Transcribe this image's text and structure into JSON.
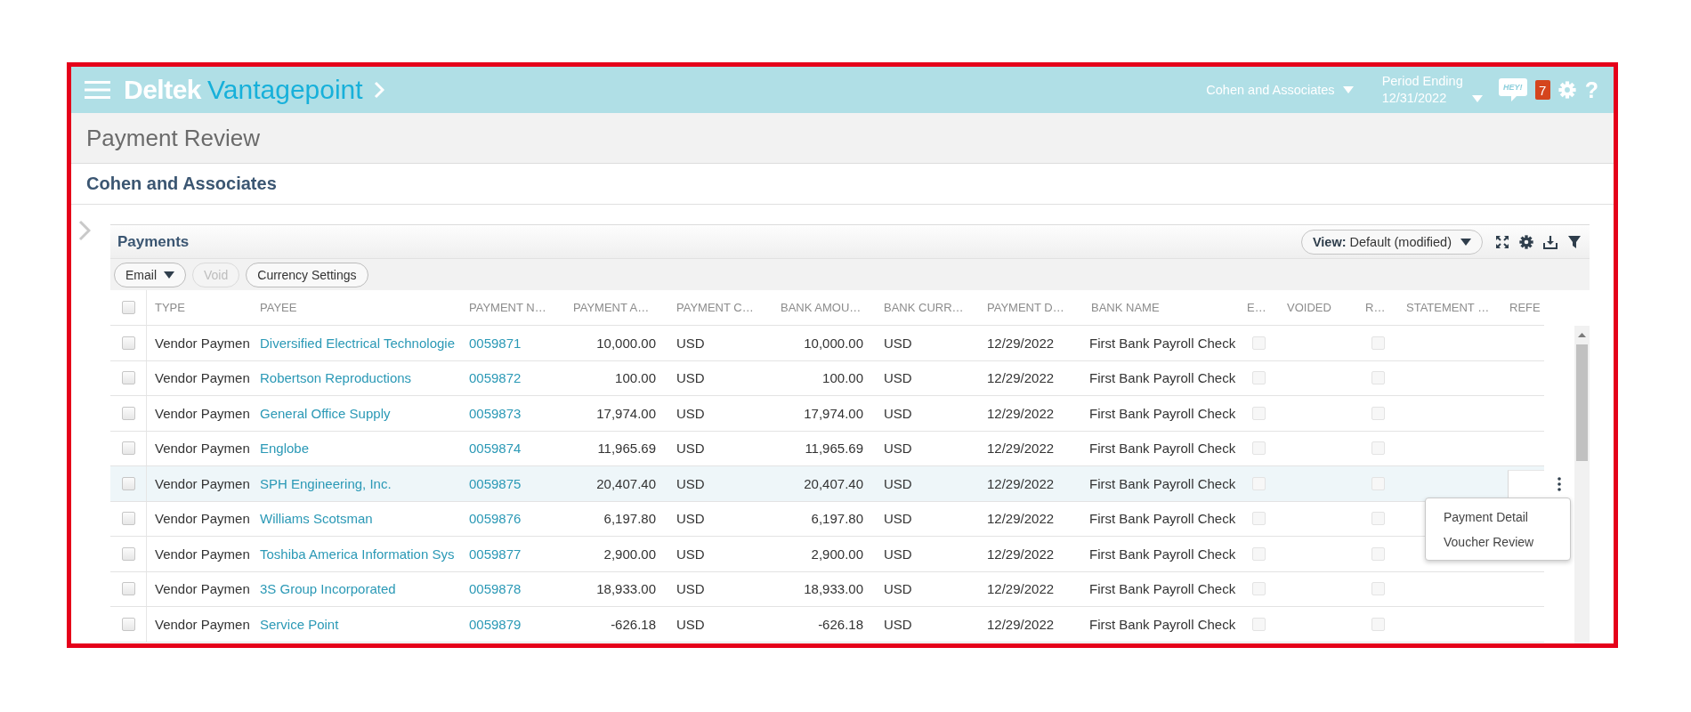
{
  "top_bar": {
    "logo": {
      "brand": "Deltek",
      "product": "Vantagepoint"
    },
    "company": "Cohen and Associates",
    "period": {
      "label": "Period Ending",
      "value": "12/31/2022"
    },
    "chat_label": "HEY!",
    "notifications": "7",
    "help": "?"
  },
  "page": {
    "title": "Payment Review",
    "company": "Cohen and Associates"
  },
  "payments": {
    "title": "Payments",
    "view": "**View:** Default (modified)",
    "toolbar": [
      {
        "label": "Email",
        "kind": "dropdown",
        "disabled": false
      },
      {
        "label": "Void",
        "kind": "button",
        "disabled": true
      },
      {
        "label": "Currency Settings",
        "kind": "button",
        "disabled": false
      }
    ],
    "table": {
      "select_all_checked": false,
      "columns": [
        "TYPE",
        "PAYEE",
        "PAYMENT N…",
        "PAYMENT A…",
        "PAYMENT C…",
        "BANK AMOU…",
        "BANK CURR…",
        "PAYMENT D…",
        "BANK NAME",
        "E…",
        "VOIDED",
        "R…",
        "STATEMENT …",
        "REFE"
      ],
      "rows": [
        {
          "checked": false,
          "highlighted": false,
          "type": "Vendor Paymen",
          "payee": "Diversified Electrical Technologie",
          "payment_number": "0059871",
          "payment_amount": "10,000.00",
          "payment_currency": "USD",
          "bank_amount": "10,000.00",
          "bank_currency": "USD",
          "payment_date": "12/29/2022",
          "bank_name": "First Bank Payroll Check",
          "e_checked": false,
          "r_checked": false
        },
        {
          "checked": false,
          "highlighted": false,
          "type": "Vendor Paymen",
          "payee": "Robertson Reproductions",
          "payment_number": "0059872",
          "payment_amount": "100.00",
          "payment_currency": "USD",
          "bank_amount": "100.00",
          "bank_currency": "USD",
          "payment_date": "12/29/2022",
          "bank_name": "First Bank Payroll Check",
          "e_checked": false,
          "r_checked": false
        },
        {
          "checked": false,
          "highlighted": false,
          "type": "Vendor Paymen",
          "payee": "General Office Supply",
          "payment_number": "0059873",
          "payment_amount": "17,974.00",
          "payment_currency": "USD",
          "bank_amount": "17,974.00",
          "bank_currency": "USD",
          "payment_date": "12/29/2022",
          "bank_name": "First Bank Payroll Check",
          "e_checked": false,
          "r_checked": false
        },
        {
          "checked": false,
          "highlighted": false,
          "type": "Vendor Paymen",
          "payee": "Englobe",
          "payment_number": "0059874",
          "payment_amount": "11,965.69",
          "payment_currency": "USD",
          "bank_amount": "11,965.69",
          "bank_currency": "USD",
          "payment_date": "12/29/2022",
          "bank_name": "First Bank Payroll Check",
          "e_checked": false,
          "r_checked": false
        },
        {
          "checked": false,
          "highlighted": true,
          "type": "Vendor Paymen",
          "payee": "SPH Engineering, Inc.",
          "payment_number": "0059875",
          "payment_amount": "20,407.40",
          "payment_currency": "USD",
          "bank_amount": "20,407.40",
          "bank_currency": "USD",
          "payment_date": "12/29/2022",
          "bank_name": "First Bank Payroll Check",
          "e_checked": false,
          "r_checked": false,
          "actions_menu": {
            "items": [
              "Payment Detail",
              "Voucher Review"
            ]
          }
        },
        {
          "checked": false,
          "highlighted": false,
          "type": "Vendor Paymen",
          "payee": "Williams Scotsman",
          "payment_number": "0059876",
          "payment_amount": "6,197.80",
          "payment_currency": "USD",
          "bank_amount": "6,197.80",
          "bank_currency": "USD",
          "payment_date": "12/29/2022",
          "bank_name": "First Bank Payroll Check",
          "e_checked": false,
          "r_checked": false
        },
        {
          "checked": false,
          "highlighted": false,
          "type": "Vendor Paymen",
          "payee": "Toshiba America Information Sys",
          "payment_number": "0059877",
          "payment_amount": "2,900.00",
          "payment_currency": "USD",
          "bank_amount": "2,900.00",
          "bank_currency": "USD",
          "payment_date": "12/29/2022",
          "bank_name": "First Bank Payroll Check",
          "e_checked": false,
          "r_checked": false
        },
        {
          "checked": false,
          "highlighted": false,
          "type": "Vendor Paymen",
          "payee": "3S Group Incorporated",
          "payment_number": "0059878",
          "payment_amount": "18,933.00",
          "payment_currency": "USD",
          "bank_amount": "18,933.00",
          "bank_currency": "USD",
          "payment_date": "12/29/2022",
          "bank_name": "First Bank Payroll Check",
          "e_checked": false,
          "r_checked": false
        },
        {
          "checked": false,
          "highlighted": false,
          "type": "Vendor Paymen",
          "payee": "Service Point",
          "payment_number": "0059879",
          "payment_amount": "-626.18",
          "payment_currency": "USD",
          "bank_amount": "-626.18",
          "bank_currency": "USD",
          "payment_date": "12/29/2022",
          "bank_name": "First Bank Payroll Check",
          "e_checked": false,
          "r_checked": false
        }
      ]
    }
  }
}
